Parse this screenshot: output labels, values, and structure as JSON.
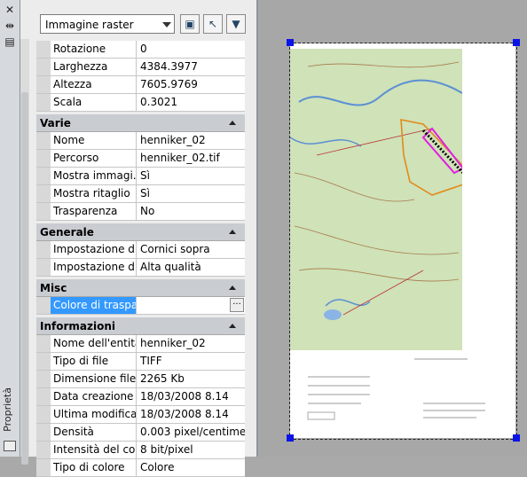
{
  "window": {
    "vertical_title": "Proprietà",
    "close_icon": "close-icon",
    "autohide_icon": "autohide-icon",
    "menu_icon": "properties-menu-icon"
  },
  "toolbar": {
    "object_type": "Immagine raster",
    "buttons": [
      "pickadd-icon",
      "select-objects-icon",
      "quick-select-icon"
    ]
  },
  "groups": [
    {
      "title": "",
      "rows": [
        {
          "name": "Rotazione",
          "value": "0"
        },
        {
          "name": "Larghezza",
          "value": "4384.3977"
        },
        {
          "name": "Altezza",
          "value": "7605.9769"
        },
        {
          "name": "Scala",
          "value": "0.3021"
        }
      ]
    },
    {
      "title": "Varie",
      "rows": [
        {
          "name": "Nome",
          "value": "henniker_02"
        },
        {
          "name": "Percorso",
          "value": "henniker_02.tif"
        },
        {
          "name": "Mostra immagi...",
          "value": "Sì"
        },
        {
          "name": "Mostra ritaglio",
          "value": "Sì"
        },
        {
          "name": "Trasparenza",
          "value": "No"
        }
      ]
    },
    {
      "title": "Generale",
      "rows": [
        {
          "name": "Impostazione d...",
          "value": "Cornici sopra"
        },
        {
          "name": "Impostazione d...",
          "value": "Alta qualità"
        }
      ]
    },
    {
      "title": "Misc",
      "rows": [
        {
          "name": "Colore di traspa...",
          "value": "",
          "selected": true
        }
      ]
    },
    {
      "title": "Informazioni",
      "rows": [
        {
          "name": "Nome dell'entità",
          "value": "henniker_02"
        },
        {
          "name": "Tipo di file",
          "value": "TIFF"
        },
        {
          "name": "Dimensione file",
          "value": "2265 Kb"
        },
        {
          "name": "Data creazione",
          "value": "18/03/2008 8.14"
        },
        {
          "name": "Ultima modifica",
          "value": "18/03/2008 8.14"
        },
        {
          "name": "Densità",
          "value": "0.003 pixel/centimet..."
        },
        {
          "name": "Intensità del col...",
          "value": "8 bit/pixel"
        },
        {
          "name": "Tipo di colore",
          "value": "Colore"
        }
      ]
    }
  ],
  "colors": {
    "selection": "#3399ff",
    "grip": "#0b14e6",
    "map_background": "#cfe2b8",
    "overlay_orange": "#e28a1a",
    "overlay_magenta": "#e020e0"
  }
}
